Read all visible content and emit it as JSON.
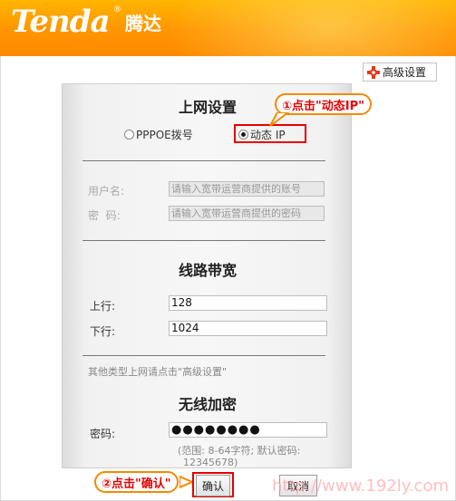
{
  "header": {
    "logo": "Tenda",
    "logo_cn": "腾达",
    "reg": "®"
  },
  "toolbar": {
    "advanced_label": "高级设置",
    "advanced_icon": "gear-icon"
  },
  "internet": {
    "title": "上网设置",
    "options": [
      "PPPOE拨号",
      "动态 IP"
    ],
    "selected": "动态 IP",
    "username_label": "用户名:",
    "username_placeholder": "请输入宽带运营商提供的账号",
    "password_label": "密  码:",
    "password_placeholder": "请输入宽带运营商提供的密码"
  },
  "bandwidth": {
    "title": "线路带宽",
    "up_label": "上行:",
    "up_value": "128",
    "down_label": "下行:",
    "down_value": "1024",
    "note": "其他类型上网请点击\"高级设置\""
  },
  "wireless": {
    "title": "无线加密",
    "password_label": "密码:",
    "password_value": "●●●●●●●●",
    "hint_line1": "(范围: 8-64字符; 默认密码:",
    "hint_line2": "12345678)"
  },
  "buttons": {
    "ok": "确认",
    "cancel": "取消"
  },
  "callouts": {
    "dynamic_ip": "①点击\"动态IP\"",
    "confirm": "②点击\"确认\""
  },
  "watermark": "http://www.192ly.com",
  "colors": {
    "header": "#ff9c00",
    "highlight": "#e60000",
    "callout_border": "#f58a00"
  }
}
